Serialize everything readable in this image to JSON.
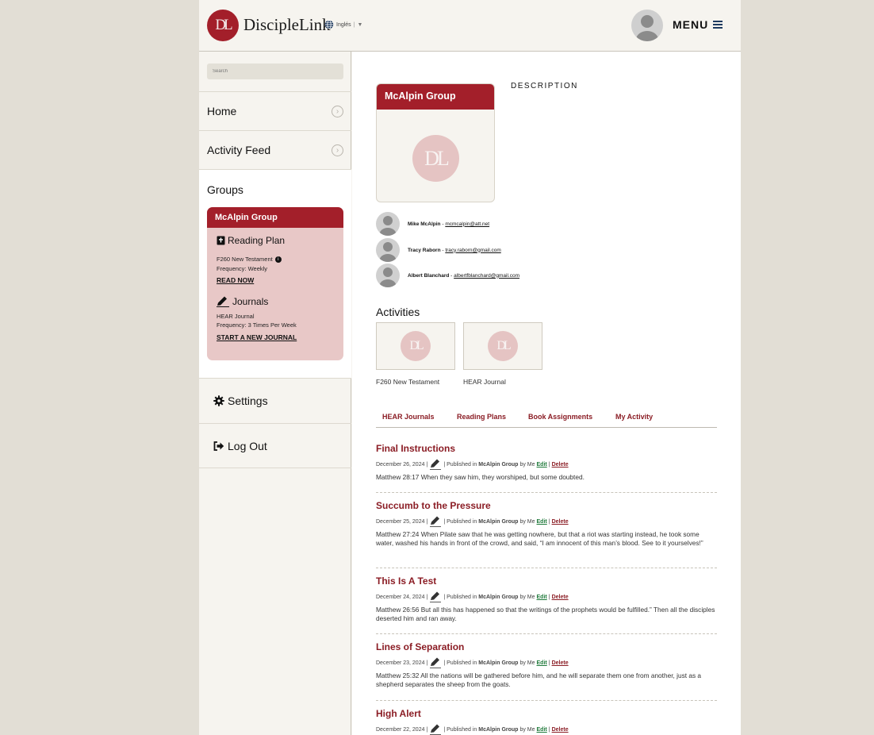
{
  "header": {
    "logo_mark": "DL",
    "brand": "DiscipleLink",
    "language": "Inglés",
    "language_sep": "|",
    "language_caret": "▼",
    "menu_label": "MENU"
  },
  "sidebar": {
    "search_placeholder": "Search",
    "nav": [
      {
        "label": "Home"
      },
      {
        "label": "Activity Feed"
      }
    ],
    "groups_title": "Groups",
    "group_card": {
      "name": "McAlpin Group",
      "reading_plan_title": "Reading Plan",
      "reading_plan_name": "F260 New Testament",
      "reading_plan_frequency": "Frequency: Weekly",
      "reading_plan_link": "READ NOW",
      "journals_title": "Journals",
      "journal_name": "HEAR Journal",
      "journal_frequency": "Frequency: 3 Times Per Week",
      "journal_link": "START A NEW JOURNAL"
    },
    "settings_label": "Settings",
    "logout_label": "Log Out"
  },
  "main": {
    "group_name": "McAlpin Group",
    "description_title": "DESCRIPTION",
    "members": [
      {
        "name": "Mike McAlpin",
        "email": "mcmcalpin@att.net"
      },
      {
        "name": "Tracy Raborn",
        "email": "tracy.raborn@gmail.com"
      },
      {
        "name": "Albert Blanchard",
        "email": "albertfblanchard@gmail.com"
      }
    ],
    "member_sep": " - ",
    "activities_title": "Activities",
    "activities": [
      {
        "label": "F260 New Testament"
      },
      {
        "label": "HEAR Journal"
      }
    ],
    "tabs": [
      {
        "label": "HEAR Journals"
      },
      {
        "label": "Reading Plans"
      },
      {
        "label": "Book Assignments"
      },
      {
        "label": "My Activity"
      }
    ],
    "meta_published": "Published in",
    "meta_group": "McAlpin Group",
    "meta_by": "by Me",
    "meta_edit": "Edit",
    "meta_delete": "Delete",
    "meta_sep": "|",
    "entries": [
      {
        "title": "Final Instructions",
        "date": "December 26, 2024",
        "text": "Matthew 28:17 When they saw him, they worshiped, but some doubted."
      },
      {
        "title": "Succumb to the Pressure",
        "date": "December 25, 2024",
        "text": "Matthew 27:24 When Pilate saw that he was getting nowhere, but that a riot was starting instead, he took some water, washed his hands in front of the crowd, and said, “I am innocent of this man’s blood. See to it yourselves!”"
      },
      {
        "title": "This Is A Test",
        "date": "December 24, 2024",
        "text": "Matthew 26:56 But all this has happened so that the writings of the prophets would be fulfilled.” Then all the disciples deserted him and ran away."
      },
      {
        "title": "Lines of Separation",
        "date": "December 23, 2024",
        "text": "Matthew 25:32 All the nations will be gathered before him, and he will separate them one from another, just as a shepherd separates the sheep from the goats."
      },
      {
        "title": "High Alert",
        "date": "December 22, 2024",
        "text": ""
      }
    ]
  },
  "colors": {
    "brand_red": "#a31f2a",
    "link_red": "#8b1d25",
    "edit_green": "#1f7a3b",
    "card_pink": "#e8c8c7"
  }
}
